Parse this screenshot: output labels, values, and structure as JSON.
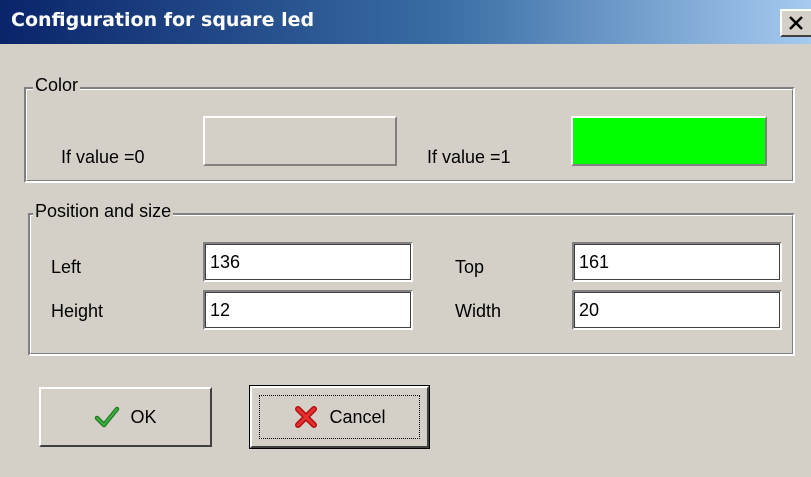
{
  "window": {
    "title": "Configuration for square led"
  },
  "color_group": {
    "legend": "Color",
    "value0_label": "If value =0",
    "value0_color": "#d4d0c8",
    "value1_label": "If value =1",
    "value1_color": "#00ff00"
  },
  "position_group": {
    "legend": "Position and size",
    "left_label": "Left",
    "left_value": "136",
    "top_label": "Top",
    "top_value": "161",
    "height_label": "Height",
    "height_value": "12",
    "width_label": "Width",
    "width_value": "20"
  },
  "buttons": {
    "ok_label": "OK",
    "ok_icon": "checkmark-icon",
    "cancel_label": "Cancel",
    "cancel_icon": "red-x-icon"
  }
}
